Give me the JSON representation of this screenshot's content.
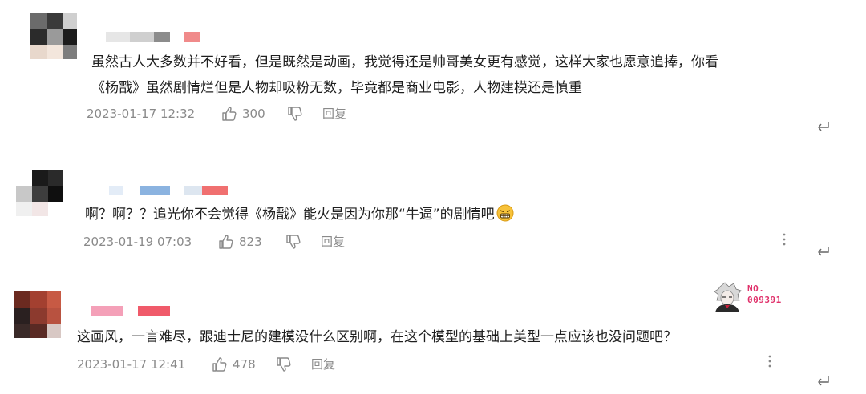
{
  "comments": [
    {
      "text_lines": [
        "虽然古人大多数并不好看，但是既然是动画，我觉得还是帅哥美女更有感觉，这样大家也愿意追捧，你看",
        "《杨戬》虽然剧情烂但是人物却吸粉无数，毕竟都是商业电影，人物建模还是慎重"
      ],
      "time": "2023-01-17 12:32",
      "likes": "300",
      "reply_label": "回复"
    },
    {
      "text_lines": [
        "啊？啊？？追光你不会觉得《杨戬》能火是因为你那“牛逼”的剧情吧"
      ],
      "time": "2023-01-19 07:03",
      "likes": "823",
      "reply_label": "回复"
    },
    {
      "text_lines": [
        "这画风，一言难尽，跟迪士尼的建模没什么区别啊，在这个模型的基础上美型一点应该也没问题吧？"
      ],
      "time": "2023-01-17 12:41",
      "likes": "478",
      "reply_label": "回复"
    }
  ],
  "badge": {
    "line1": "NO.",
    "line2": "009391"
  },
  "colors": {
    "text": "#1f1f1f",
    "meta": "#8a8a8a",
    "badge": "#e0306a"
  }
}
